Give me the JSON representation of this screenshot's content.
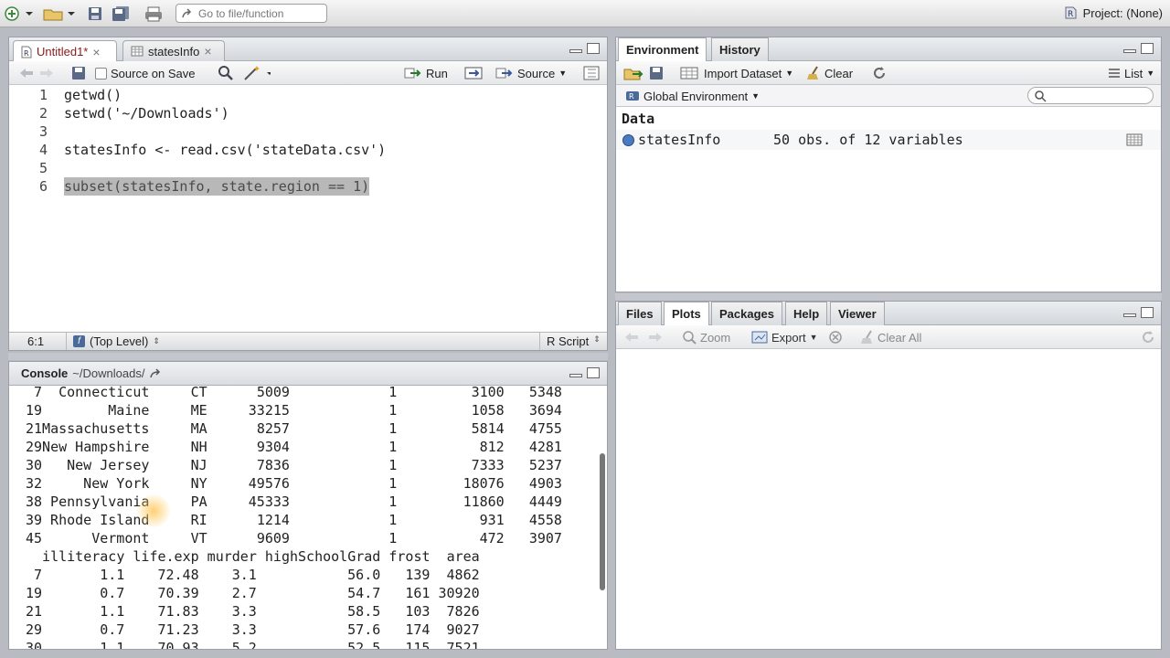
{
  "topbar": {
    "goto_placeholder": "Go to file/function",
    "project_label": "Project: (None)"
  },
  "editor": {
    "tabs": [
      {
        "label": "Untitled1*",
        "close": "×"
      },
      {
        "label": "statesInfo",
        "close": "×"
      }
    ],
    "toolbar": {
      "source_on_save": "Source on Save",
      "run": "Run",
      "source": "Source"
    },
    "lines": [
      {
        "num": "1",
        "code": "getwd()"
      },
      {
        "num": "2",
        "code": "setwd('~/Downloads')"
      },
      {
        "num": "3",
        "code": ""
      },
      {
        "num": "4",
        "code": "statesInfo <- read.csv('stateData.csv')"
      },
      {
        "num": "5",
        "code": ""
      },
      {
        "num": "6",
        "code": "subset(statesInfo, state.region == 1)"
      }
    ],
    "status": {
      "position": "6:1",
      "scope": "(Top Level)",
      "filetype": "R Script"
    }
  },
  "console": {
    "title": "Console",
    "path": "~/Downloads/",
    "rows1": [
      [
        "7",
        "Connecticut",
        "CT",
        "5009",
        "1",
        "3100",
        "5348"
      ],
      [
        "19",
        "Maine",
        "ME",
        "33215",
        "1",
        "1058",
        "3694"
      ],
      [
        "21",
        "Massachusetts",
        "MA",
        "8257",
        "1",
        "5814",
        "4755"
      ],
      [
        "29",
        "New Hampshire",
        "NH",
        "9304",
        "1",
        "812",
        "4281"
      ],
      [
        "30",
        "New Jersey",
        "NJ",
        "7836",
        "1",
        "7333",
        "5237"
      ],
      [
        "32",
        "New York",
        "NY",
        "49576",
        "1",
        "18076",
        "4903"
      ],
      [
        "38",
        "Pennsylvania",
        "PA",
        "45333",
        "1",
        "11860",
        "4449"
      ],
      [
        "39",
        "Rhode Island",
        "RI",
        "1214",
        "1",
        "931",
        "4558"
      ],
      [
        "45",
        "Vermont",
        "VT",
        "9609",
        "1",
        "472",
        "3907"
      ]
    ],
    "header2": "  illiteracy life.exp murder highSchoolGrad frost  area",
    "rows2": [
      [
        "7",
        "1.1",
        "72.48",
        "3.1",
        "56.0",
        "139",
        "4862"
      ],
      [
        "19",
        "0.7",
        "70.39",
        "2.7",
        "54.7",
        "161",
        "30920"
      ],
      [
        "21",
        "1.1",
        "71.83",
        "3.3",
        "58.5",
        "103",
        "7826"
      ],
      [
        "29",
        "0.7",
        "71.23",
        "3.3",
        "57.6",
        "174",
        "9027"
      ],
      [
        "30",
        "1.1",
        "70.93",
        "5.2",
        "52.5",
        "115",
        "7521"
      ]
    ]
  },
  "env": {
    "tabs": [
      "Environment",
      "History"
    ],
    "import_label": "Import Dataset",
    "clear_label": "Clear",
    "list_label": "List",
    "scope_label": "Global Environment",
    "section_label": "Data",
    "item_name": "statesInfo",
    "item_desc": "50 obs. of 12 variables"
  },
  "files": {
    "tabs": [
      "Files",
      "Plots",
      "Packages",
      "Help",
      "Viewer"
    ],
    "zoom_label": "Zoom",
    "export_label": "Export",
    "clear_all_label": "Clear All"
  }
}
